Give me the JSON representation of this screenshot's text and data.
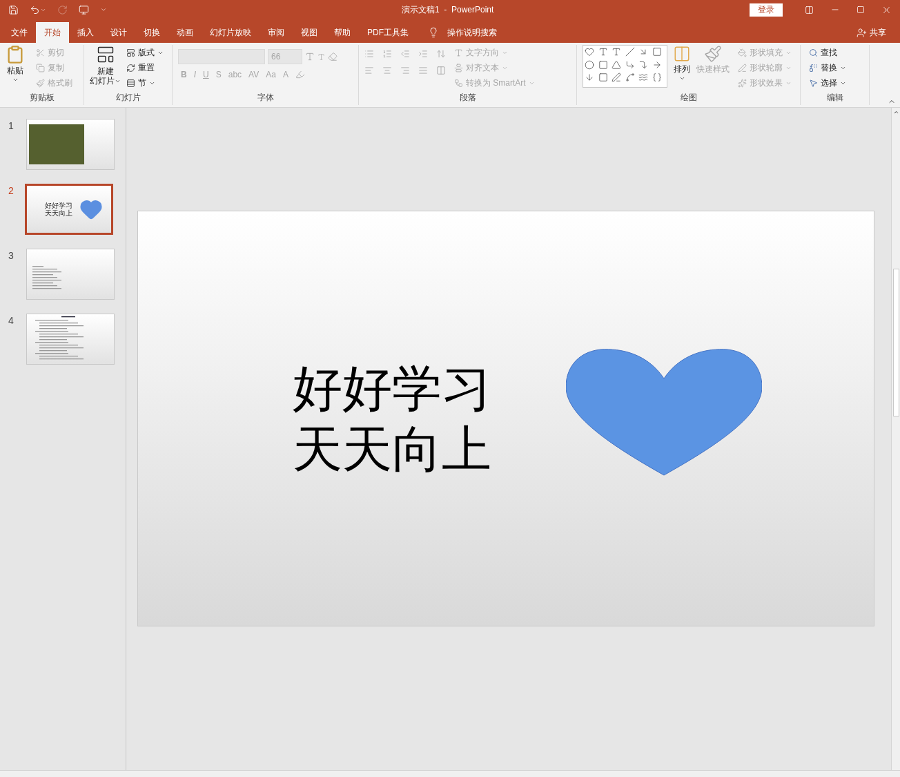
{
  "window": {
    "title": "演示文稿1  -  PowerPoint",
    "login": "登录"
  },
  "tabs": [
    {
      "label": "文件",
      "selected": false
    },
    {
      "label": "开始",
      "selected": true
    },
    {
      "label": "插入",
      "selected": false
    },
    {
      "label": "设计",
      "selected": false
    },
    {
      "label": "切换",
      "selected": false
    },
    {
      "label": "动画",
      "selected": false
    },
    {
      "label": "幻灯片放映",
      "selected": false
    },
    {
      "label": "审阅",
      "selected": false
    },
    {
      "label": "视图",
      "selected": false
    },
    {
      "label": "帮助",
      "selected": false
    },
    {
      "label": "PDF工具集",
      "selected": false
    }
  ],
  "tell_me": "操作说明搜索",
  "share": "共享",
  "clipboard": {
    "label": "剪贴板",
    "paste": "粘贴",
    "items": [
      {
        "label": "剪切",
        "disabled": true
      },
      {
        "label": "复制",
        "disabled": true
      },
      {
        "label": "格式刷",
        "disabled": true
      }
    ]
  },
  "slides_group": {
    "label": "幻灯片",
    "new_slide": [
      "新建",
      "幻灯片"
    ],
    "items": [
      {
        "label": "版式"
      },
      {
        "label": "重置"
      },
      {
        "label": "节"
      }
    ]
  },
  "font": {
    "label": "字体",
    "size": "66",
    "buttons": [
      "B",
      "I",
      "U",
      "S",
      "abc",
      "AV",
      "Aa",
      "A"
    ]
  },
  "paragraph": {
    "label": "段落",
    "items": [
      {
        "label": "文字方向"
      },
      {
        "label": "对齐文本"
      },
      {
        "label": "转换为 SmartArt"
      }
    ]
  },
  "drawing": {
    "label": "绘图",
    "arrange": "排列",
    "quick_styles": "快速样式",
    "items": [
      {
        "label": "形状填充"
      },
      {
        "label": "形状轮廓"
      },
      {
        "label": "形状效果"
      }
    ]
  },
  "editing": {
    "label": "编辑",
    "items": [
      {
        "label": "查找"
      },
      {
        "label": "替换"
      },
      {
        "label": "选择"
      }
    ]
  },
  "thumbnails": [
    {
      "number": "1",
      "selected": false,
      "kind": "photo"
    },
    {
      "number": "2",
      "selected": true,
      "kind": "title",
      "lines": [
        "好好学习",
        "天天向上"
      ]
    },
    {
      "number": "3",
      "selected": false,
      "kind": "text"
    },
    {
      "number": "4",
      "selected": false,
      "kind": "list"
    }
  ],
  "slide": {
    "lines": [
      "好好学习",
      "天天向上"
    ]
  }
}
